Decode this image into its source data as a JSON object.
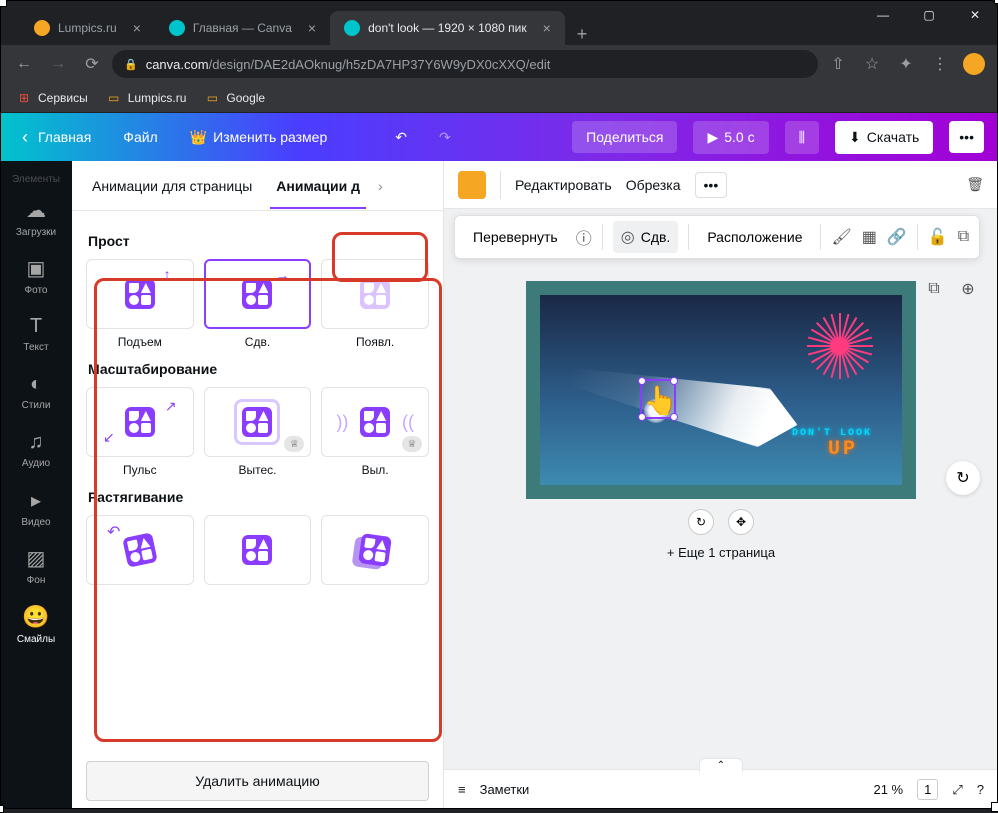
{
  "window": {
    "minimize": "—",
    "maximize": "▢",
    "close": "✕"
  },
  "tabs": [
    {
      "title": "Lumpics.ru",
      "favicon_color": "#f5a623"
    },
    {
      "title": "Главная — Canva",
      "favicon_color": "#00c4cc"
    },
    {
      "title": "don't look — 1920 × 1080 пик",
      "favicon_color": "#00c4cc",
      "active": true
    }
  ],
  "newtab": "+",
  "addressbar": {
    "domain": "canva.com",
    "path": "/design/DAE2dAOknug/h5zDA7HP37Y6W9yDX0cXXQ/edit"
  },
  "bookmarks": [
    {
      "label": "Сервисы",
      "icon": "⊞",
      "color": "#e84d3d"
    },
    {
      "label": "Lumpics.ru",
      "icon": "▭",
      "color": "#f5a623"
    },
    {
      "label": "Google",
      "icon": "▭",
      "color": "#f5a623"
    }
  ],
  "toolbar": {
    "home": "Главная",
    "file": "Файл",
    "resize": "Изменить размер",
    "share": "Поделиться",
    "duration": "5.0 с",
    "download": "Скачать"
  },
  "iconbar": {
    "items": [
      {
        "label": "Элементы",
        "icon": "◇"
      },
      {
        "label": "Загрузки",
        "icon": "☁"
      },
      {
        "label": "Фото",
        "icon": "▣"
      },
      {
        "label": "Текст",
        "icon": "T"
      },
      {
        "label": "Стили",
        "icon": "🎨"
      },
      {
        "label": "Аудио",
        "icon": "♫"
      },
      {
        "label": "Видео",
        "icon": "▸"
      },
      {
        "label": "Фон",
        "icon": "▨"
      },
      {
        "label": "Смайлы",
        "icon": "😀",
        "active": true
      }
    ]
  },
  "anim_tabs": {
    "page": "Анимации для страницы",
    "element": "Анимации д"
  },
  "float_toolbar": {
    "flip": "Перевернуть",
    "shift": "Сдв.",
    "arrange": "Расположение"
  },
  "sections": {
    "simple_title": "Прост",
    "simple": [
      {
        "label": "Подъем"
      },
      {
        "label": "Сдв.",
        "selected": true
      },
      {
        "label": "Появл."
      }
    ],
    "scale_title": "Масштабирование",
    "scale": [
      {
        "label": "Пульс"
      },
      {
        "label": "Вытес.",
        "premium": true
      },
      {
        "label": "Выл.",
        "premium": true
      }
    ],
    "stretch_title": "Растягивание",
    "stretch": [
      {},
      {},
      {}
    ]
  },
  "delete_anim": "Удалить анимацию",
  "ctx": {
    "edit": "Редактировать",
    "crop": "Обрезка",
    "more": "•••"
  },
  "canvas": {
    "dont_look": "DON'T LOOK",
    "up": "UP",
    "add_page": "+ Еще 1 страница"
  },
  "bottombar": {
    "notes": "Заметки",
    "zoom": "21 %",
    "pages": "1"
  }
}
